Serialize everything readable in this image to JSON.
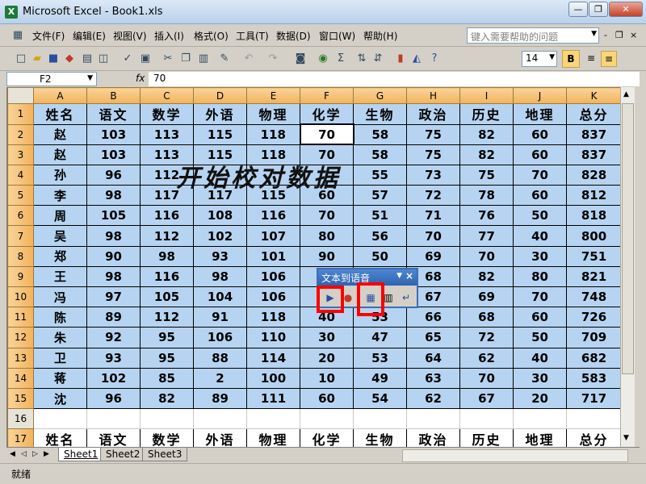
{
  "window": {
    "title": "Microsoft Excel - Book1.xls",
    "app_icon": "X"
  },
  "window_buttons": {
    "minimize": "—",
    "restore": "❐",
    "close": "✕"
  },
  "menu": [
    "文件(F)",
    "编辑(E)",
    "视图(V)",
    "插入(I)",
    "格式(O)",
    "工具(T)",
    "数据(D)",
    "窗口(W)",
    "帮助(H)"
  ],
  "help_box": {
    "placeholder": "键入需要帮助的问题"
  },
  "mdi_buttons": [
    "-",
    "❐",
    "×"
  ],
  "toolbar": {
    "font_size": "14",
    "bold_label": "B"
  },
  "formula_bar": {
    "name_box": "F2",
    "fx": "fx",
    "value": "70"
  },
  "columns": [
    "A",
    "B",
    "C",
    "D",
    "E",
    "F",
    "G",
    "H",
    "I",
    "J",
    "K"
  ],
  "rows": [
    [
      "姓名",
      "语文",
      "数学",
      "外语",
      "物理",
      "化学",
      "生物",
      "政治",
      "历史",
      "地理",
      "总分"
    ],
    [
      "赵",
      "103",
      "113",
      "115",
      "118",
      "70",
      "58",
      "75",
      "82",
      "60",
      "837"
    ],
    [
      "赵",
      "103",
      "113",
      "115",
      "118",
      "70",
      "58",
      "75",
      "82",
      "60",
      "837"
    ],
    [
      "孙",
      "96",
      "112",
      "",
      "",
      "",
      "55",
      "73",
      "75",
      "70",
      "828"
    ],
    [
      "李",
      "98",
      "117",
      "117",
      "115",
      "60",
      "57",
      "72",
      "78",
      "60",
      "812"
    ],
    [
      "周",
      "105",
      "116",
      "108",
      "116",
      "70",
      "51",
      "71",
      "76",
      "50",
      "818"
    ],
    [
      "吴",
      "98",
      "112",
      "102",
      "107",
      "80",
      "56",
      "70",
      "77",
      "40",
      "800"
    ],
    [
      "郑",
      "90",
      "98",
      "93",
      "101",
      "90",
      "50",
      "69",
      "70",
      "30",
      "751"
    ],
    [
      "王",
      "98",
      "116",
      "98",
      "106",
      "",
      "",
      "68",
      "82",
      "80",
      "821"
    ],
    [
      "冯",
      "97",
      "105",
      "104",
      "106",
      "",
      "",
      "67",
      "69",
      "70",
      "748"
    ],
    [
      "陈",
      "89",
      "112",
      "91",
      "118",
      "40",
      "53",
      "66",
      "68",
      "60",
      "726"
    ],
    [
      "朱",
      "92",
      "95",
      "106",
      "110",
      "30",
      "47",
      "65",
      "72",
      "50",
      "709"
    ],
    [
      "卫",
      "93",
      "95",
      "88",
      "114",
      "20",
      "53",
      "64",
      "62",
      "40",
      "682"
    ],
    [
      "蒋",
      "102",
      "85",
      "2",
      "100",
      "10",
      "49",
      "63",
      "70",
      "30",
      "583"
    ],
    [
      "沈",
      "96",
      "82",
      "89",
      "111",
      "60",
      "54",
      "62",
      "67",
      "20",
      "717"
    ],
    [
      "",
      "",
      "",
      "",
      "",
      "",
      "",
      "",
      "",
      "",
      ""
    ],
    [
      "姓名",
      "语文",
      "数学",
      "外语",
      "物理",
      "化学",
      "生物",
      "政治",
      "历史",
      "地理",
      "总分"
    ]
  ],
  "sheets": [
    "Sheet1",
    "Sheet2",
    "Sheet3"
  ],
  "status": "就绪",
  "overlay": "开始校对数据",
  "tts_toolbar": {
    "title": "文本到语音"
  },
  "colors": {
    "cell_fill": "#b6d4f1",
    "header_fill": "#f2b35b",
    "highlight": "#ff0000",
    "tts_title": "#2f64b0"
  }
}
